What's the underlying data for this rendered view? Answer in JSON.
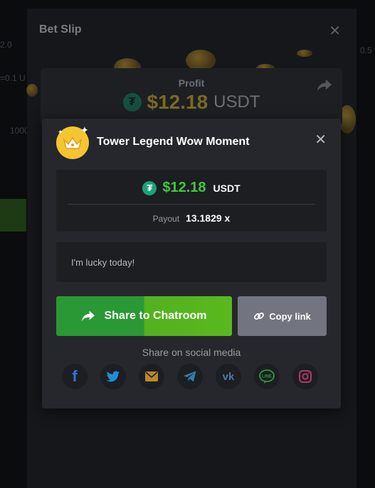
{
  "betslip": {
    "title": "Bet Slip"
  },
  "profit_card": {
    "label": "Profit",
    "amount": "$12.18",
    "currency": "USDT"
  },
  "background": {
    "left_top": "2.0",
    "left_mid": "=0.1 U",
    "left_value": "1000",
    "right_top": "0.5"
  },
  "modal": {
    "title": "Tower Legend Wow Moment",
    "amount": "$12.18",
    "currency": "USDT",
    "payout_label": "Payout",
    "payout_value": "13.1829 x",
    "message": "I'm lucky today!",
    "share_button": "Share to Chatroom",
    "copy_button": "Copy link",
    "social_label": "Share on social media",
    "social_icons": [
      "facebook-icon",
      "twitter-icon",
      "email-icon",
      "telegram-icon",
      "vk-icon",
      "line-icon",
      "instagram-icon"
    ]
  },
  "colors": {
    "accent_green": "#3ec93a",
    "tether": "#1ba27a",
    "modal_bg": "#25272c",
    "panel_bg": "#1c1e22",
    "share_button": "#2a9834",
    "copy_button": "#72747f"
  }
}
